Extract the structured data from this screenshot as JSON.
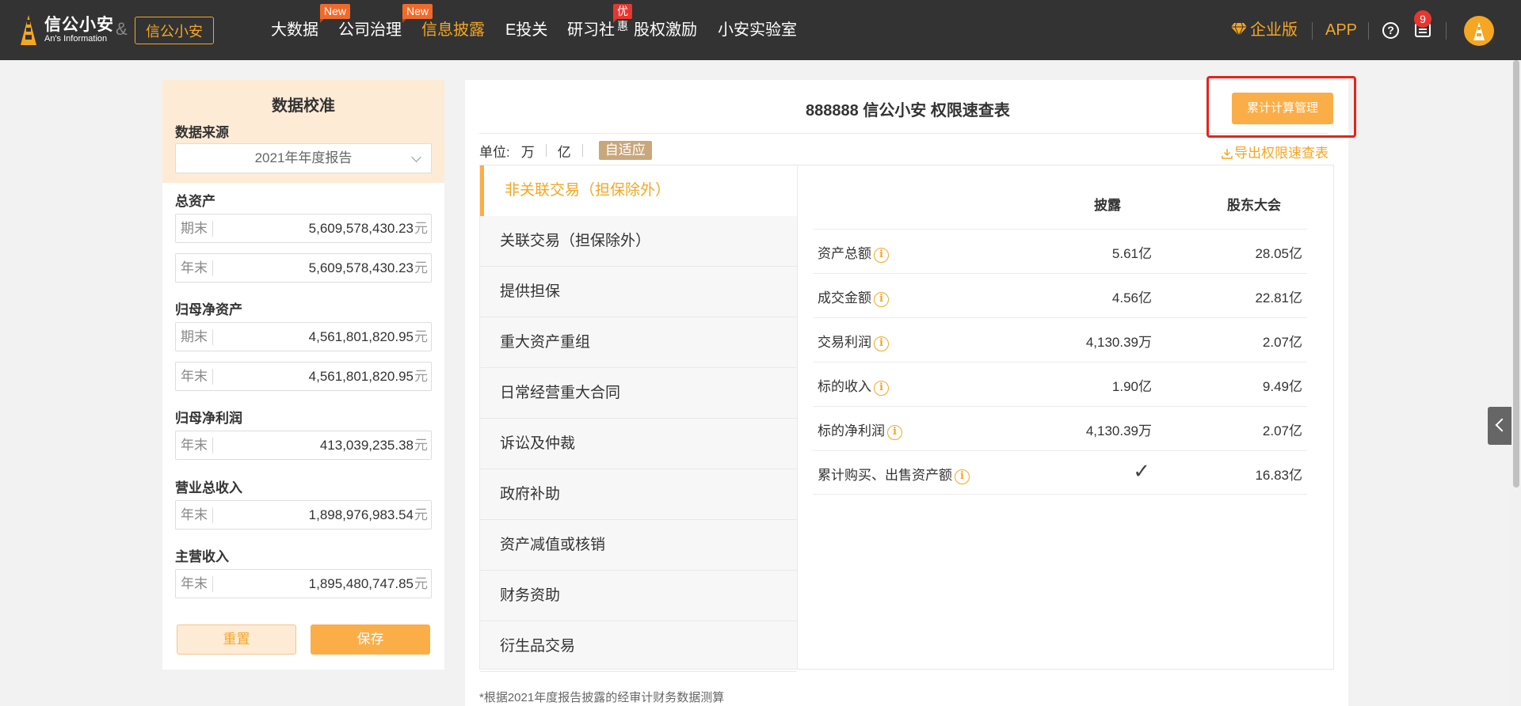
{
  "header": {
    "logo_cn": "信公小安",
    "logo_en": "An's Information",
    "amp": "&",
    "brand_box": "信公小安",
    "nav": [
      {
        "label": "大数据",
        "tag": ""
      },
      {
        "label": "公司治理",
        "tag": "New"
      },
      {
        "label": "信息披露",
        "tag": "New",
        "active": true
      },
      {
        "label": "E投关",
        "tag": ""
      },
      {
        "label": "研习社",
        "tag": "优惠"
      },
      {
        "label": "股权激励",
        "tag": ""
      },
      {
        "label": "小安实验室",
        "tag": ""
      }
    ],
    "enterprise": "企业版",
    "app": "APP",
    "help": "?",
    "message_badge": "9",
    "accent_color": "#f5a623"
  },
  "left_panel": {
    "title": "数据校准",
    "source_label": "数据来源",
    "source_value": "2021年年度报告",
    "groups": [
      {
        "label": "总资产",
        "fields": [
          {
            "prefix": "期末",
            "value": "5,609,578,430.23",
            "unit": "元"
          },
          {
            "prefix": "年末",
            "value": "5,609,578,430.23",
            "unit": "元"
          }
        ]
      },
      {
        "label": "归母净资产",
        "fields": [
          {
            "prefix": "期末",
            "value": "4,561,801,820.95",
            "unit": "元"
          },
          {
            "prefix": "年末",
            "value": "4,561,801,820.95",
            "unit": "元"
          }
        ]
      },
      {
        "label": "归母净利润",
        "fields": [
          {
            "prefix": "年末",
            "value": "413,039,235.38",
            "unit": "元"
          }
        ]
      },
      {
        "label": "营业总收入",
        "fields": [
          {
            "prefix": "年末",
            "value": "1,898,976,983.54",
            "unit": "元"
          }
        ]
      },
      {
        "label": "主营收入",
        "fields": [
          {
            "prefix": "年末",
            "value": "1,895,480,747.85",
            "unit": "元"
          }
        ]
      }
    ],
    "reset_label": "重置",
    "save_label": "保存"
  },
  "main": {
    "title": "888888 信公小安 权限速查表",
    "calc_button": "累计计算管理",
    "unit_label": "单位:",
    "units": [
      "万",
      "亿",
      "自适应"
    ],
    "active_unit": "自适应",
    "export_label": "导出权限速查表",
    "tabs": [
      "非关联交易（担保除外）",
      "关联交易（担保除外）",
      "提供担保",
      "重大资产重组",
      "日常经营重大合同",
      "诉讼及仲裁",
      "政府补助",
      "资产减值或核销",
      "财务资助",
      "衍生品交易"
    ],
    "active_tab": "非关联交易（担保除外）",
    "table": {
      "headers": [
        "披露",
        "股东大会"
      ],
      "rows": [
        {
          "name": "资产总额",
          "disclosure": "5.61亿",
          "shareholders": "28.05亿"
        },
        {
          "name": "成交金额",
          "disclosure": "4.56亿",
          "shareholders": "22.81亿"
        },
        {
          "name": "交易利润",
          "disclosure": "4,130.39万",
          "shareholders": "2.07亿"
        },
        {
          "name": "标的收入",
          "disclosure": "1.90亿",
          "shareholders": "9.49亿"
        },
        {
          "name": "标的净利润",
          "disclosure": "4,130.39万",
          "shareholders": "2.07亿"
        },
        {
          "name": "累计购买、出售资产额",
          "disclosure": "✓",
          "shareholders": "16.83亿"
        }
      ]
    },
    "footnote": "*根据2021年度报告披露的经审计财务数据测算"
  }
}
